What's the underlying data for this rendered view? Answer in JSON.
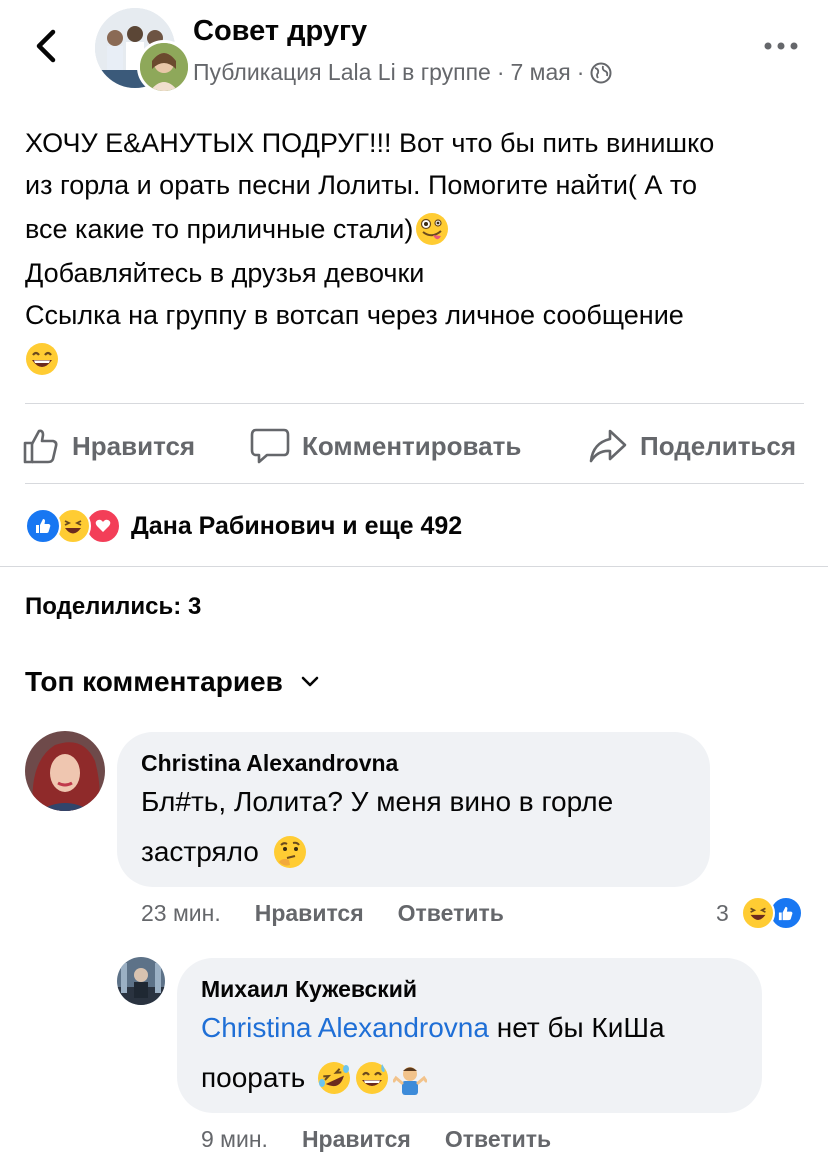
{
  "header": {
    "group_name": "Совет другу",
    "posted_by": "Публикация Lala Li в группе",
    "separator": "·",
    "date": "7 мая",
    "separator2": "·"
  },
  "post": {
    "lines": [
      "ХОЧУ Е&АНУТЫХ ПОДРУГ!!! Вот что бы пить винишко",
      "из горла и орать песни Лолиты. Помогите найти( А то",
      "все какие то приличные стали)",
      "Добавляйтесь в друзья девочки",
      "Ссылка на группу в вотсап через личное сообщение"
    ]
  },
  "actions": {
    "like": "Нравится",
    "comment": "Комментировать",
    "share": "Поделиться"
  },
  "reactions": {
    "summary": "Дана Рабинович и еще 492"
  },
  "shares": "Поделились: 3",
  "comments_filter": "Топ комментариев",
  "comments": [
    {
      "author": "Christina Alexandrovna",
      "text_line1": "Бл#ть, Лолита? У меня вино в горле",
      "text_line2": "застряло",
      "time": "23 мин.",
      "like": "Нравится",
      "reply": "Ответить",
      "reaction_count": "3"
    },
    {
      "author": "Михаил Кужевский",
      "mention": "Christina Alexandrovna",
      "text_line1": " нет бы КиШа",
      "text_line2": "поорать",
      "time": "9 мин.",
      "like": "Нравится",
      "reply": "Ответить"
    }
  ],
  "colors": {
    "secondary_text": "#65676b",
    "link": "#1f6fd6",
    "bubble": "#f0f2f5",
    "like_blue": "#1877f2",
    "love_red": "#f33e58",
    "emoji_yellow": "#ffcc33"
  }
}
